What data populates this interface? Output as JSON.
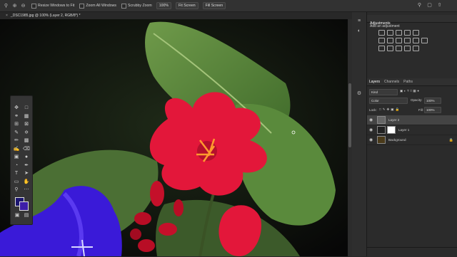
{
  "options_bar": {
    "resize_windows": "Resize Windows to Fit",
    "zoom_all": "Zoom All Windows",
    "scrubby_zoom": "Scrubby Zoom",
    "zoom_level": "100%",
    "fit_screen": "Fit Screen",
    "fill_screen": "Fill Screen"
  },
  "document_tab": {
    "close": "×",
    "title": "_DSC1985.jpg @ 100% (Layer 2, RGB/8*) *"
  },
  "adjustments": {
    "tab": "Adjustments",
    "subtitle": "Add an adjustment"
  },
  "layers_panel": {
    "tabs": [
      "Layers",
      "Channels",
      "Paths"
    ],
    "filter_kind": "Kind",
    "blend_mode": "Color",
    "opacity_label": "Opacity:",
    "opacity_value": "100%",
    "lock_label": "Lock:",
    "fill_label": "Fill:",
    "fill_value": "100%",
    "layers": [
      {
        "name": "Layer 2",
        "selected": true
      },
      {
        "name": "Layer 1",
        "selected": false
      },
      {
        "name": "Background",
        "selected": false
      }
    ]
  },
  "colors": {
    "foreground": "#1c1670",
    "background": "#3d1ea8"
  }
}
